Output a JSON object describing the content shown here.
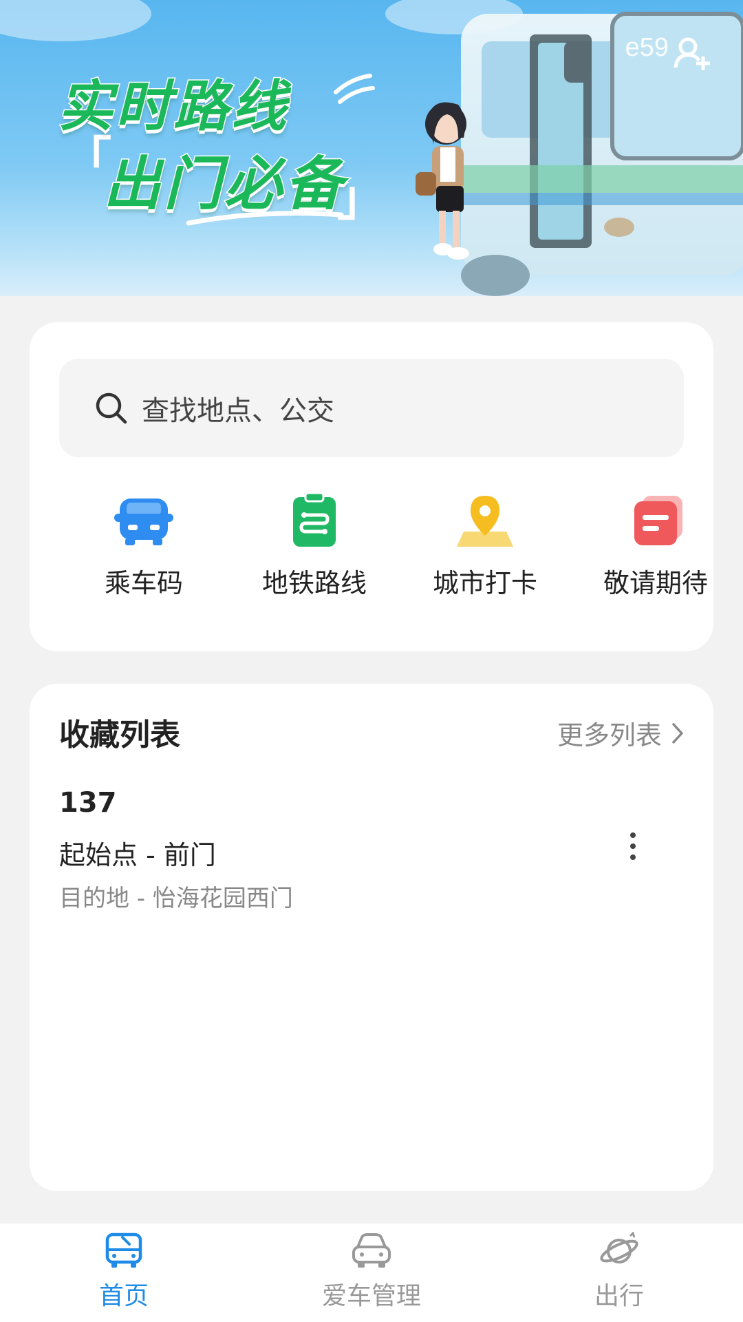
{
  "banner": {
    "slogan_line1": "实时路线",
    "slogan_line2": "出门必备",
    "bracket_open": "「",
    "bracket_close": "」",
    "user_id_text": "e59",
    "add_user_icon": "add-user-icon"
  },
  "search": {
    "placeholder": "查找地点、公交",
    "icon": "search-icon"
  },
  "quick_actions": [
    {
      "label": "乘车码",
      "icon": "bus-front-icon",
      "color": "#2f8cf0"
    },
    {
      "label": "地铁路线",
      "icon": "metro-route-icon",
      "color": "#1fb865"
    },
    {
      "label": "城市打卡",
      "icon": "location-pin-icon",
      "color": "#f5bd1f"
    },
    {
      "label": "敬请期待",
      "icon": "coming-soon-icon",
      "color": "#f0595b"
    }
  ],
  "favorites": {
    "title": "收藏列表",
    "more_label": "更多列表",
    "items": [
      {
        "route": "137",
        "origin": "起始点 - 前门",
        "destination": "目的地 - 怡海花园西门"
      }
    ]
  },
  "tabbar": {
    "tabs": [
      {
        "label": "首页",
        "icon": "bus-icon",
        "active": true
      },
      {
        "label": "爱车管理",
        "icon": "car-icon",
        "active": false
      },
      {
        "label": "出行",
        "icon": "planet-icon",
        "active": false
      }
    ]
  },
  "colors": {
    "accent": "#1e8be6",
    "slogan_green": "#1bb85a",
    "background": "#f2f2f2"
  }
}
